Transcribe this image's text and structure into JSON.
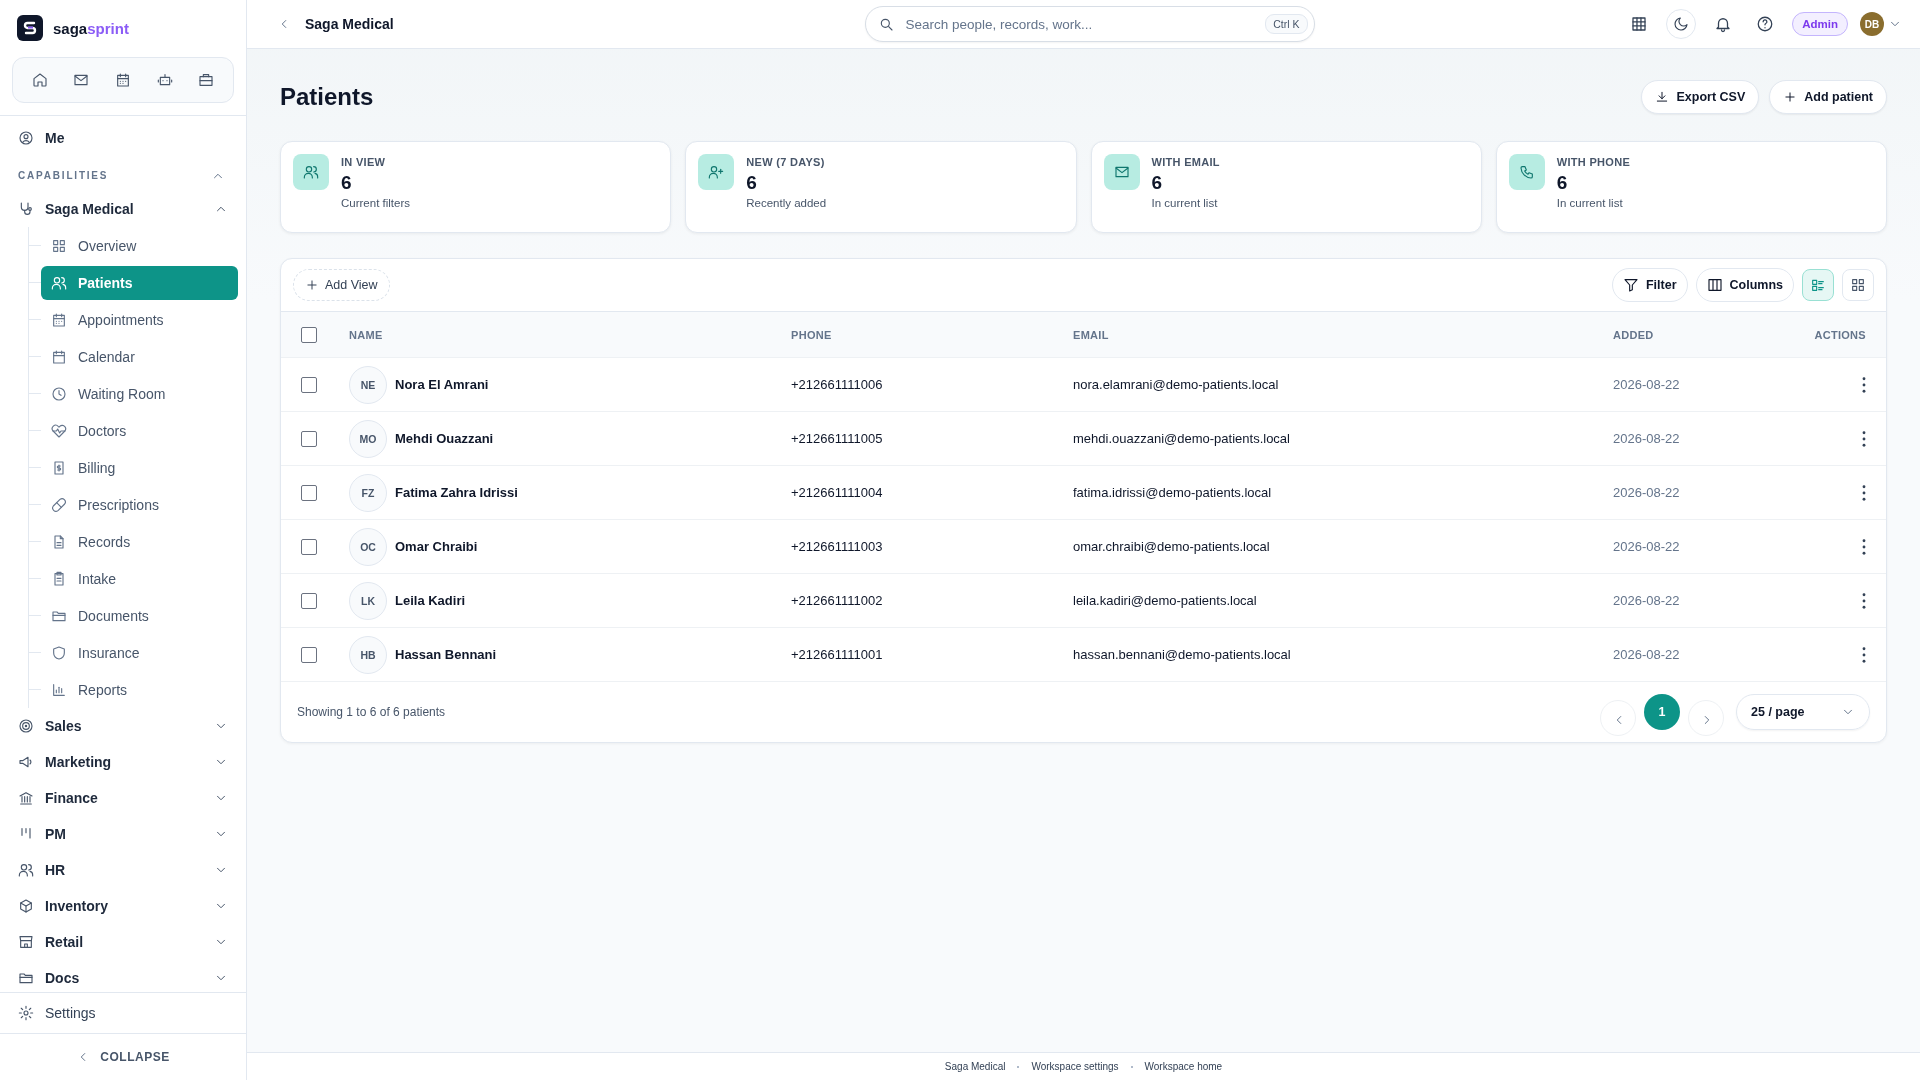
{
  "brand": {
    "name_start": "saga",
    "name_end": "sprint"
  },
  "sidebar": {
    "me": "Me",
    "section": {
      "label": "CAPABILITIES",
      "expanded": true
    },
    "module": {
      "label": "Saga Medical",
      "expanded": true,
      "items": [
        {
          "label": "Overview",
          "selected": false
        },
        {
          "label": "Patients",
          "selected": true
        },
        {
          "label": "Appointments",
          "selected": false
        },
        {
          "label": "Calendar",
          "selected": false
        },
        {
          "label": "Waiting Room",
          "selected": false
        },
        {
          "label": "Doctors",
          "selected": false
        },
        {
          "label": "Billing",
          "selected": false
        },
        {
          "label": "Prescriptions",
          "selected": false
        },
        {
          "label": "Records",
          "selected": false
        },
        {
          "label": "Intake",
          "selected": false
        },
        {
          "label": "Documents",
          "selected": false
        },
        {
          "label": "Insurance",
          "selected": false
        },
        {
          "label": "Reports",
          "selected": false
        }
      ]
    },
    "other_modules": [
      {
        "label": "Sales",
        "expanded": false
      },
      {
        "label": "Marketing",
        "expanded": false
      },
      {
        "label": "Finance",
        "expanded": false
      },
      {
        "label": "PM",
        "expanded": false
      },
      {
        "label": "HR",
        "expanded": false
      },
      {
        "label": "Inventory",
        "expanded": false
      },
      {
        "label": "Retail",
        "expanded": false
      },
      {
        "label": "Docs",
        "expanded": false
      }
    ],
    "settings": "Settings",
    "collapse": "COLLAPSE"
  },
  "topbar": {
    "title": "Saga Medical",
    "search": {
      "placeholder": "Search people, records, work...",
      "shortcut": "Ctrl K"
    },
    "role": "Admin",
    "avatar": "DB"
  },
  "page": {
    "title": "Patients",
    "actions": [
      "Export CSV",
      "Add patient"
    ]
  },
  "stats": [
    {
      "label": "IN VIEW",
      "value": "6",
      "caption": "Current filters"
    },
    {
      "label": "NEW (7 DAYS)",
      "value": "6",
      "caption": "Recently added"
    },
    {
      "label": "WITH EMAIL",
      "value": "6",
      "caption": "In current list"
    },
    {
      "label": "WITH PHONE",
      "value": "6",
      "caption": "In current list"
    }
  ],
  "toolbar": {
    "add_view": "Add View",
    "filter": "Filter",
    "columns": "Columns",
    "view_modes": [
      {
        "selected": true
      },
      {
        "selected": false
      }
    ]
  },
  "table": {
    "all_checked": false,
    "columns": [
      "NAME",
      "PHONE",
      "EMAIL",
      "ADDED",
      "ACTIONS"
    ],
    "rows": [
      {
        "initials": "NE",
        "name": "Nora El Amrani",
        "phone": "+212661111006",
        "email": "nora.elamrani@demo-patients.local",
        "added": "2026-08-22",
        "checked": false
      },
      {
        "initials": "MO",
        "name": "Mehdi Ouazzani",
        "phone": "+212661111005",
        "email": "mehdi.ouazzani@demo-patients.local",
        "added": "2026-08-22",
        "checked": false
      },
      {
        "initials": "FZ",
        "name": "Fatima Zahra Idrissi",
        "phone": "+212661111004",
        "email": "fatima.idrissi@demo-patients.local",
        "added": "2026-08-22",
        "checked": false
      },
      {
        "initials": "OC",
        "name": "Omar Chraibi",
        "phone": "+212661111003",
        "email": "omar.chraibi@demo-patients.local",
        "added": "2026-08-22",
        "checked": false
      },
      {
        "initials": "LK",
        "name": "Leila Kadiri",
        "phone": "+212661111002",
        "email": "leila.kadiri@demo-patients.local",
        "added": "2026-08-22",
        "checked": false
      },
      {
        "initials": "HB",
        "name": "Hassan Bennani",
        "phone": "+212661111001",
        "email": "hassan.bennani@demo-patients.local",
        "added": "2026-08-22",
        "checked": false
      }
    ],
    "summary": "Showing 1 to 6 of 6 patients",
    "pages": [
      {
        "label": "1",
        "selected": true
      }
    ],
    "per_page": "25 / page"
  },
  "footer": [
    "Saga Medical",
    "Workspace settings",
    "Workspace home"
  ]
}
